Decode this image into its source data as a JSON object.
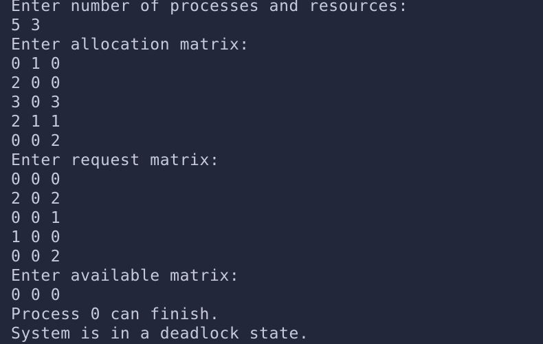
{
  "terminal": {
    "lines": [
      "Enter number of processes and resources:",
      "5 3",
      "Enter allocation matrix:",
      "0 1 0",
      "2 0 0",
      "3 0 3",
      "2 1 1",
      "0 0 2",
      "Enter request matrix:",
      "0 0 0",
      "2 0 2",
      "0 0 1",
      "1 0 0",
      "0 0 2",
      "Enter available matrix:",
      "0 0 0",
      "Process 0 can finish.",
      "System is in a deadlock state."
    ]
  },
  "colors": {
    "background": "#22283a",
    "text": "#c6cbdb"
  }
}
